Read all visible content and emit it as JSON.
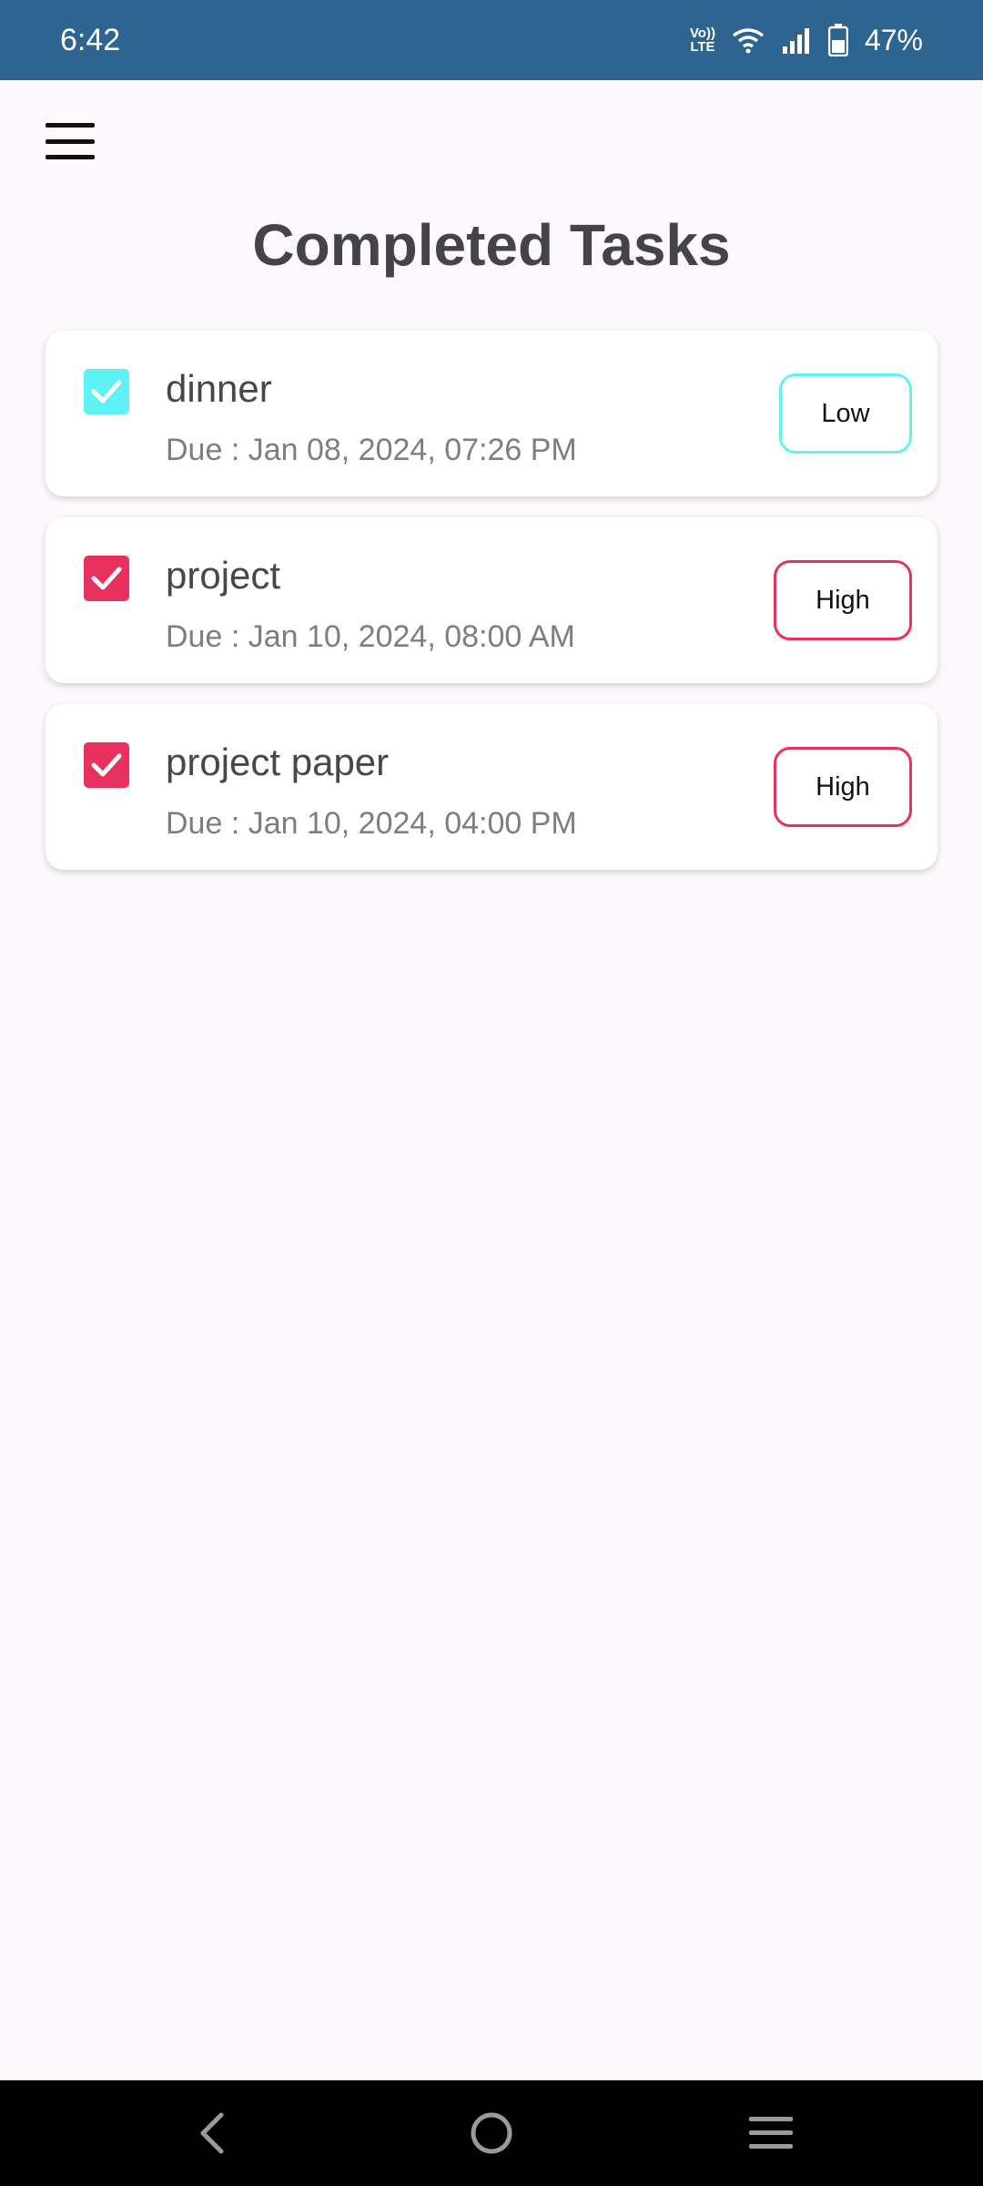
{
  "status_bar": {
    "time": "6:42",
    "volte": "Vo)) LTE",
    "battery_percent": "47%"
  },
  "header": {
    "menu_icon": "hamburger-menu-icon",
    "title": "Completed Tasks"
  },
  "tasks": [
    {
      "name": "dinner",
      "due": "Due : Jan 08, 2024, 07:26 PM",
      "priority": "Low",
      "checked": true,
      "color": "#5ef2f4"
    },
    {
      "name": "project",
      "due": "Due : Jan 10, 2024, 08:00 AM",
      "priority": "High",
      "checked": true,
      "color": "#e8315e"
    },
    {
      "name": "project paper",
      "due": "Due : Jan 10, 2024, 04:00 PM",
      "priority": "High",
      "checked": true,
      "color": "#e8315e"
    }
  ],
  "nav_bar": {
    "back_icon": "back-icon",
    "home_icon": "home-icon",
    "recents_icon": "recents-icon"
  },
  "colors": {
    "status_bar": "#2d6490",
    "background": "#fdf8fc",
    "low_priority": "#5ef2f4",
    "high_priority": "#e8315e"
  }
}
